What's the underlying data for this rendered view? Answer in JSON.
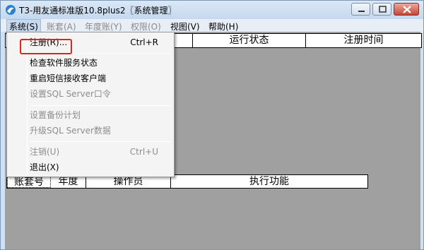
{
  "window": {
    "title": "T3-用友通标准版10.8plus2〖系统管理〗"
  },
  "menubar": {
    "items": [
      {
        "label": "系统(S)",
        "state": "active"
      },
      {
        "label": "账套(A)",
        "state": "disabled"
      },
      {
        "label": "年度账(Y)",
        "state": "disabled"
      },
      {
        "label": "权限(O)",
        "state": "disabled"
      },
      {
        "label": "视图(V)",
        "state": "enabled"
      },
      {
        "label": "帮助(H)",
        "state": "enabled"
      }
    ]
  },
  "top_table": {
    "headers": [
      "",
      "运行状态",
      "注册时间"
    ]
  },
  "bottom_table": {
    "headers": [
      "账套号",
      "年度",
      "操作员",
      "执行功能"
    ]
  },
  "system_menu": {
    "items": [
      {
        "label": "注册(R)...",
        "shortcut": "Ctrl+R",
        "enabled": true,
        "highlighted": true
      },
      {
        "label": "检查软件服务状态",
        "shortcut": "",
        "enabled": true
      },
      {
        "label": "重启短信接收客户端",
        "shortcut": "",
        "enabled": true
      },
      {
        "label": "设置SQL Server口令",
        "shortcut": "",
        "enabled": false
      },
      {
        "label": "设置备份计划",
        "shortcut": "",
        "enabled": false
      },
      {
        "label": "升级SQL Server数据",
        "shortcut": "",
        "enabled": false
      },
      {
        "label": "注销(U)",
        "shortcut": "Ctrl+U",
        "enabled": false
      },
      {
        "label": "退出(X)",
        "shortcut": "",
        "enabled": true
      }
    ]
  },
  "colors": {
    "highlight_border": "#e2231a",
    "client_background": "#a0a0a0",
    "titlebar": "#cfe0f2"
  }
}
